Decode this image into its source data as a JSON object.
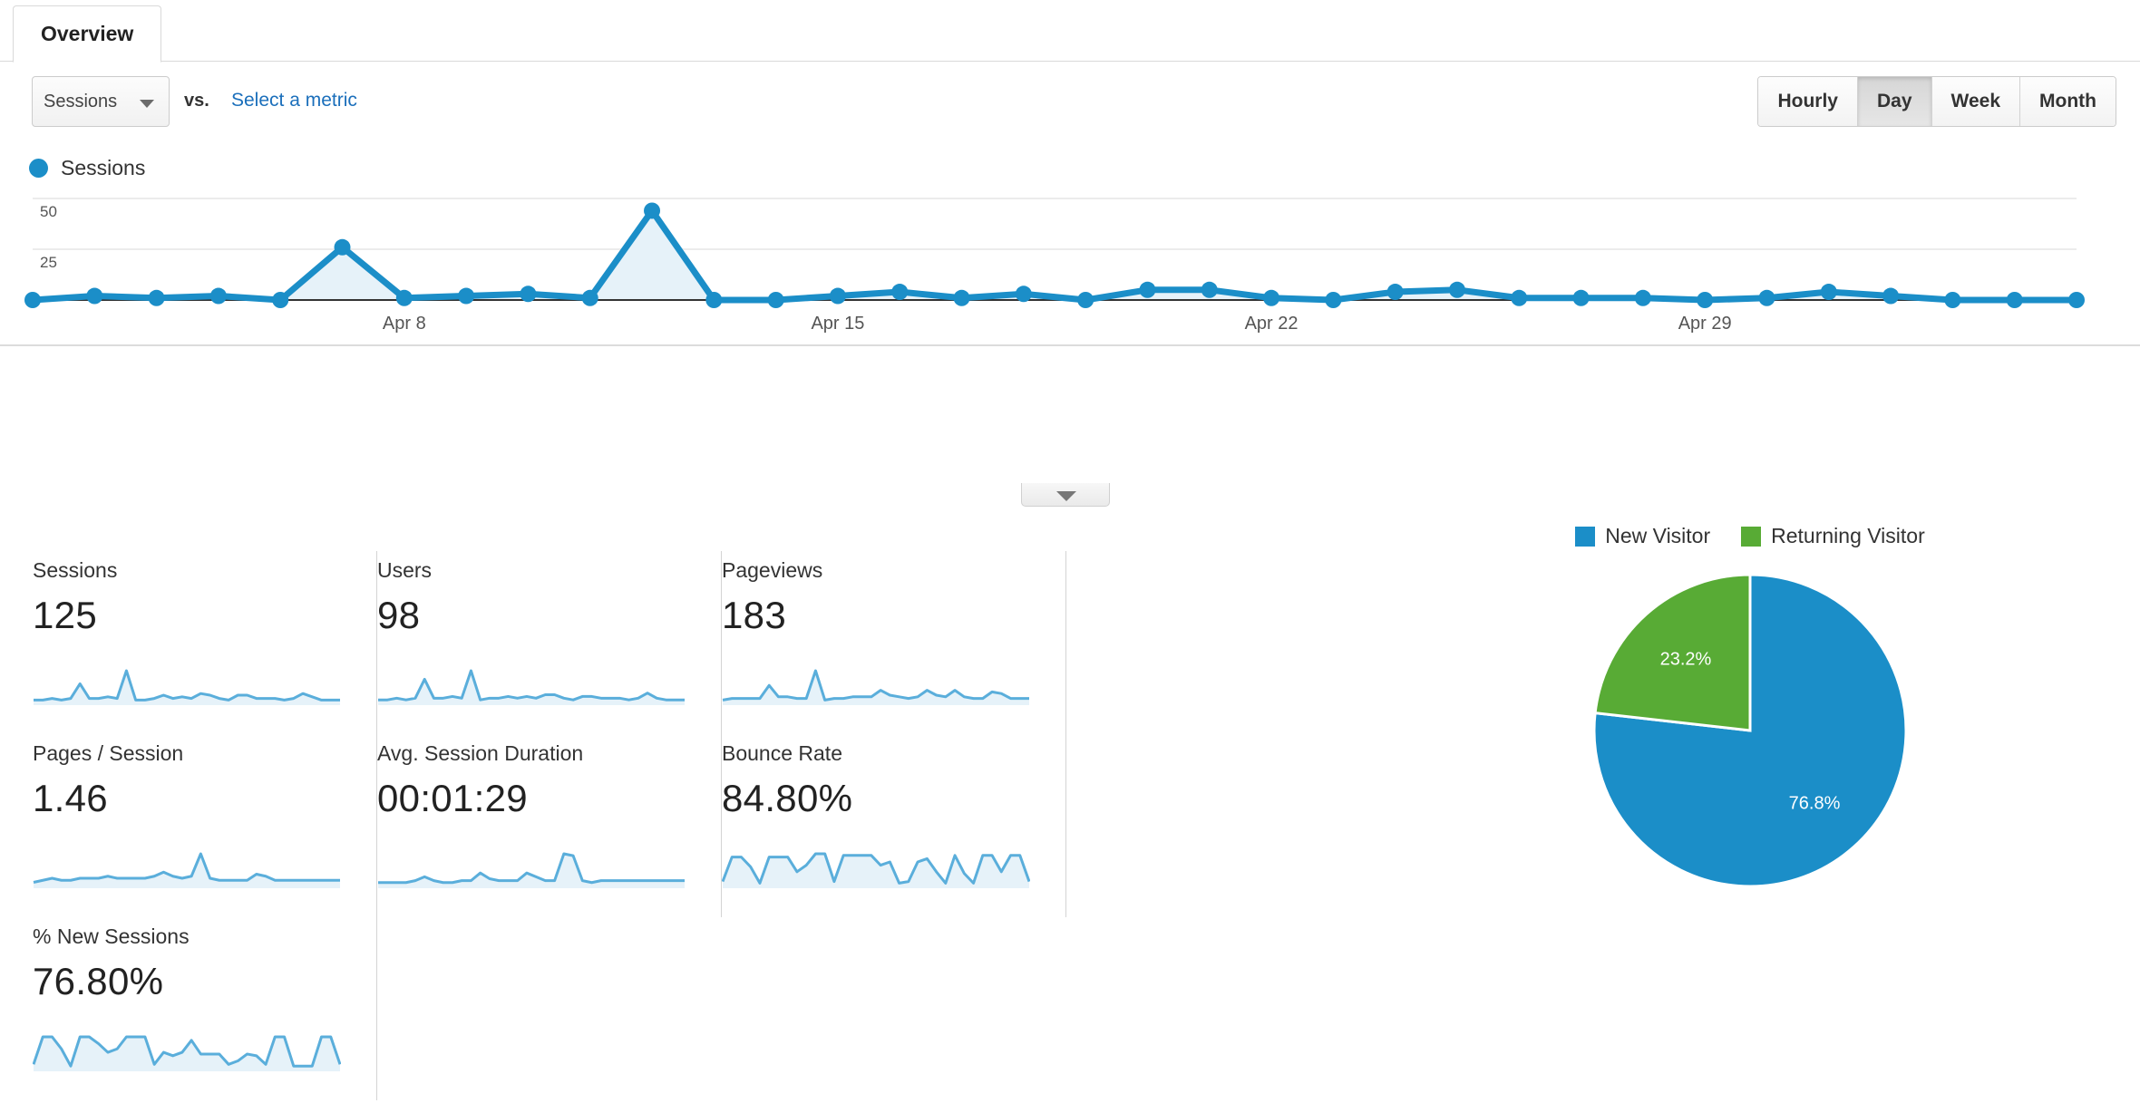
{
  "tab": {
    "label": "Overview"
  },
  "controls": {
    "metric_select_value": "Sessions",
    "vs_label": "vs.",
    "select_metric_link": "Select a metric",
    "granularity": [
      {
        "label": "Hourly",
        "active": false
      },
      {
        "label": "Day",
        "active": true
      },
      {
        "label": "Week",
        "active": false
      },
      {
        "label": "Month",
        "active": false
      }
    ]
  },
  "colors": {
    "series_blue": "#1b8ec8",
    "area_fill": "#e6f2f9",
    "returning_green": "#58ab35",
    "link_blue": "#1b6fbb",
    "sparkline_blue": "#5aaedb"
  },
  "legend": {
    "series_label": "Sessions"
  },
  "chart_data": [
    {
      "type": "line",
      "title": "Sessions",
      "xlabel": "",
      "ylabel": "Sessions",
      "ylim": [
        0,
        50
      ],
      "yticks": [
        50,
        25
      ],
      "grid": true,
      "legend_position": "top-left",
      "xtick_labels": [
        "Apr 8",
        "Apr 15",
        "Apr 22",
        "Apr 29"
      ],
      "xtick_indices": [
        6,
        13,
        20,
        27
      ],
      "x": [
        "Apr 2",
        "Apr 3",
        "Apr 4",
        "Apr 5",
        "Apr 6",
        "Apr 7",
        "Apr 8",
        "Apr 9",
        "Apr 10",
        "Apr 11",
        "Apr 12",
        "Apr 13",
        "Apr 14",
        "Apr 15",
        "Apr 16",
        "Apr 17",
        "Apr 18",
        "Apr 19",
        "Apr 20",
        "Apr 21",
        "Apr 22",
        "Apr 23",
        "Apr 24",
        "Apr 25",
        "Apr 26",
        "Apr 27",
        "Apr 28",
        "Apr 29",
        "Apr 30",
        "May 1",
        "May 2",
        "May 3",
        "May 4",
        "May 5"
      ],
      "values": [
        0,
        2,
        1,
        2,
        0,
        26,
        1,
        2,
        3,
        1,
        44,
        0,
        0,
        2,
        4,
        1,
        3,
        0,
        5,
        5,
        1,
        0,
        4,
        5,
        1,
        1,
        1,
        0,
        1,
        4,
        2,
        0,
        0,
        0
      ],
      "series": [
        {
          "name": "Sessions",
          "values": [
            0,
            2,
            1,
            2,
            0,
            26,
            1,
            2,
            3,
            1,
            44,
            0,
            0,
            2,
            4,
            1,
            3,
            0,
            5,
            5,
            1,
            0,
            4,
            5,
            1,
            1,
            1,
            0,
            1,
            4,
            2,
            0,
            0,
            0
          ]
        }
      ]
    },
    {
      "type": "pie",
      "title": "",
      "labels": [
        "New Visitor",
        "Returning Visitor"
      ],
      "values": [
        76.8,
        23.2
      ],
      "value_labels": [
        "76.8%",
        "23.2%"
      ],
      "colors": [
        "#1b8ec8",
        "#58ab35"
      ],
      "legend_position": "top"
    }
  ],
  "metric_cards": [
    [
      {
        "title": "Sessions",
        "value": "125",
        "sparkline": [
          2,
          2,
          3,
          2,
          3,
          12,
          3,
          3,
          4,
          3,
          20,
          2,
          2,
          3,
          5,
          3,
          4,
          3,
          6,
          5,
          3,
          2,
          5,
          5,
          3,
          3,
          3,
          2,
          3,
          6,
          4,
          2,
          2,
          2
        ]
      },
      {
        "title": "Users",
        "value": "98",
        "sparkline": [
          2,
          2,
          3,
          2,
          3,
          14,
          3,
          3,
          4,
          3,
          19,
          2,
          3,
          3,
          4,
          3,
          4,
          3,
          5,
          5,
          3,
          2,
          4,
          4,
          3,
          3,
          3,
          2,
          3,
          6,
          3,
          2,
          2,
          2
        ]
      },
      {
        "title": "Pageviews",
        "value": "183",
        "sparkline": [
          2,
          3,
          3,
          3,
          3,
          11,
          4,
          4,
          3,
          3,
          20,
          2,
          3,
          3,
          4,
          4,
          4,
          8,
          5,
          4,
          3,
          4,
          8,
          5,
          4,
          8,
          4,
          3,
          3,
          7,
          6,
          3,
          3,
          3
        ]
      }
    ],
    [
      {
        "title": "Pages / Session",
        "value": "1.46",
        "sparkline": [
          2,
          3,
          4,
          3,
          3,
          4,
          4,
          4,
          5,
          4,
          4,
          4,
          4,
          5,
          7,
          5,
          4,
          5,
          16,
          4,
          3,
          3,
          3,
          3,
          6,
          5,
          3,
          3,
          3,
          3,
          3,
          3,
          3,
          3
        ]
      },
      {
        "title": "Avg. Session Duration",
        "value": "00:01:29",
        "sparkline": [
          2,
          2,
          2,
          2,
          3,
          5,
          3,
          2,
          2,
          3,
          3,
          7,
          4,
          3,
          3,
          3,
          7,
          5,
          3,
          3,
          17,
          16,
          3,
          2,
          3,
          3,
          3,
          3,
          3,
          3,
          3,
          3,
          3,
          3
        ]
      },
      {
        "title": "Bounce Rate",
        "value": "84.80%",
        "sparkline": [
          3,
          18,
          18,
          12,
          2,
          18,
          18,
          18,
          9,
          13,
          20,
          20,
          3,
          19,
          19,
          19,
          19,
          13,
          15,
          2,
          3,
          15,
          17,
          9,
          2,
          19,
          8,
          2,
          19,
          19,
          9,
          19,
          19,
          3
        ]
      }
    ],
    [
      {
        "title": "% New Sessions",
        "value": "76.80%",
        "sparkline": [
          3,
          19,
          19,
          12,
          2,
          19,
          19,
          15,
          10,
          12,
          19,
          19,
          19,
          3,
          10,
          8,
          10,
          17,
          9,
          9,
          9,
          3,
          5,
          9,
          8,
          3,
          19,
          19,
          2,
          2,
          2,
          19,
          19,
          3
        ]
      }
    ]
  ]
}
